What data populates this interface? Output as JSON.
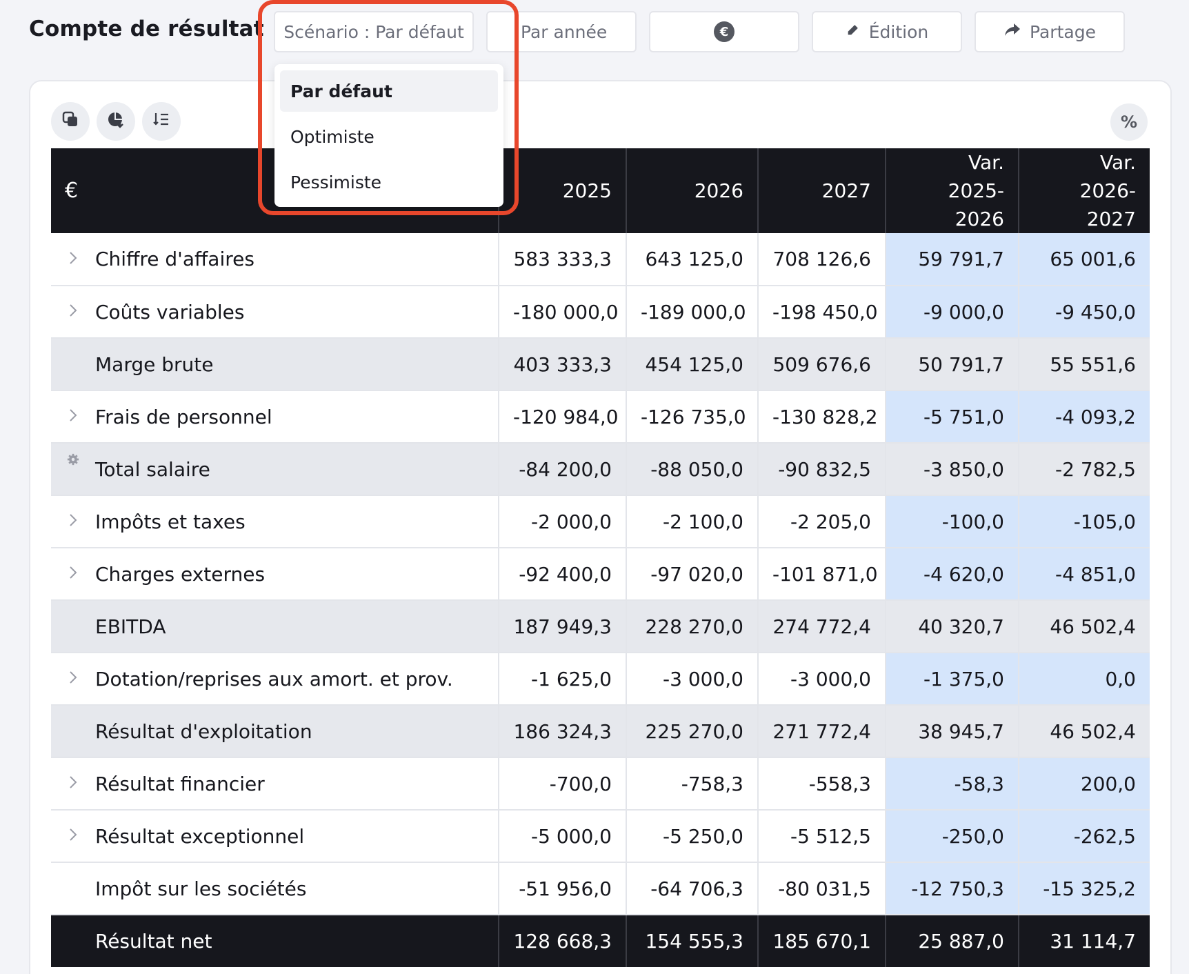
{
  "header": {
    "title": "Compte de résultat",
    "scenario_label": "Scénario : Par défaut",
    "period_label": "Par année",
    "edit_label": "Édition",
    "share_label": "Partage",
    "currency_glyph": "€"
  },
  "scenario_menu": {
    "items": [
      {
        "label": "Par défaut",
        "selected": true
      },
      {
        "label": "Optimiste",
        "selected": false
      },
      {
        "label": "Pessimiste",
        "selected": false
      }
    ]
  },
  "toolbar": {
    "percent_label": "%"
  },
  "table": {
    "header": [
      "€",
      "2025",
      "2026",
      "2027",
      "Var.\n2025-2026",
      "Var.\n2026-2027"
    ],
    "rows": [
      {
        "label": "Chiffre d'affaires",
        "type": "detail",
        "icon": "chevron",
        "values": [
          "583 333,3",
          "643 125,0",
          "708 126,6",
          "59 791,7",
          "65 001,6"
        ]
      },
      {
        "label": "Coûts variables",
        "type": "detail",
        "icon": "chevron",
        "values": [
          "-180 000,0",
          "-189 000,0",
          "-198 450,0",
          "-9 000,0",
          "-9 450,0"
        ]
      },
      {
        "label": "Marge brute",
        "type": "subtotal",
        "icon": "",
        "values": [
          "403 333,3",
          "454 125,0",
          "509 676,6",
          "50 791,7",
          "55 551,6"
        ]
      },
      {
        "label": "Frais de personnel",
        "type": "detail",
        "icon": "chevron",
        "values": [
          "-120 984,0",
          "-126 735,0",
          "-130 828,2",
          "-5 751,0",
          "-4 093,2"
        ]
      },
      {
        "label": "Total salaire",
        "type": "subtotal",
        "icon": "gear",
        "values": [
          "-84 200,0",
          "-88 050,0",
          "-90 832,5",
          "-3 850,0",
          "-2 782,5"
        ]
      },
      {
        "label": "Impôts et taxes",
        "type": "detail",
        "icon": "chevron",
        "values": [
          "-2 000,0",
          "-2 100,0",
          "-2 205,0",
          "-100,0",
          "-105,0"
        ]
      },
      {
        "label": "Charges externes",
        "type": "detail",
        "icon": "chevron",
        "values": [
          "-92 400,0",
          "-97 020,0",
          "-101 871,0",
          "-4 620,0",
          "-4 851,0"
        ]
      },
      {
        "label": "EBITDA",
        "type": "subtotal",
        "icon": "",
        "values": [
          "187 949,3",
          "228 270,0",
          "274 772,4",
          "40 320,7",
          "46 502,4"
        ]
      },
      {
        "label": "Dotation/reprises aux amort. et prov.",
        "type": "detail",
        "icon": "chevron",
        "values": [
          "-1 625,0",
          "-3 000,0",
          "-3 000,0",
          "-1 375,0",
          "0,0"
        ]
      },
      {
        "label": "Résultat d'exploitation",
        "type": "subtotal",
        "icon": "",
        "values": [
          "186 324,3",
          "225 270,0",
          "271 772,4",
          "38 945,7",
          "46 502,4"
        ]
      },
      {
        "label": "Résultat financier",
        "type": "detail",
        "icon": "chevron",
        "values": [
          "-700,0",
          "-758,3",
          "-558,3",
          "-58,3",
          "200,0"
        ]
      },
      {
        "label": "Résultat exceptionnel",
        "type": "detail",
        "icon": "chevron",
        "values": [
          "-5 000,0",
          "-5 250,0",
          "-5 512,5",
          "-250,0",
          "-262,5"
        ]
      },
      {
        "label": "Impôt sur les sociétés",
        "type": "detail",
        "icon": "",
        "values": [
          "-51 956,0",
          "-64 706,3",
          "-80 031,5",
          "-12 750,3",
          "-15 325,2"
        ]
      },
      {
        "label": "Résultat net",
        "type": "total",
        "icon": "",
        "values": [
          "128 668,3",
          "154 555,3",
          "185 670,1",
          "25 887,0",
          "31 114,7"
        ]
      }
    ]
  },
  "colors": {
    "header_bg": "#16171d",
    "variation_bg": "#d5e5fb",
    "subtotal_bg": "#e6e8ed",
    "highlight": "#e8472c"
  }
}
